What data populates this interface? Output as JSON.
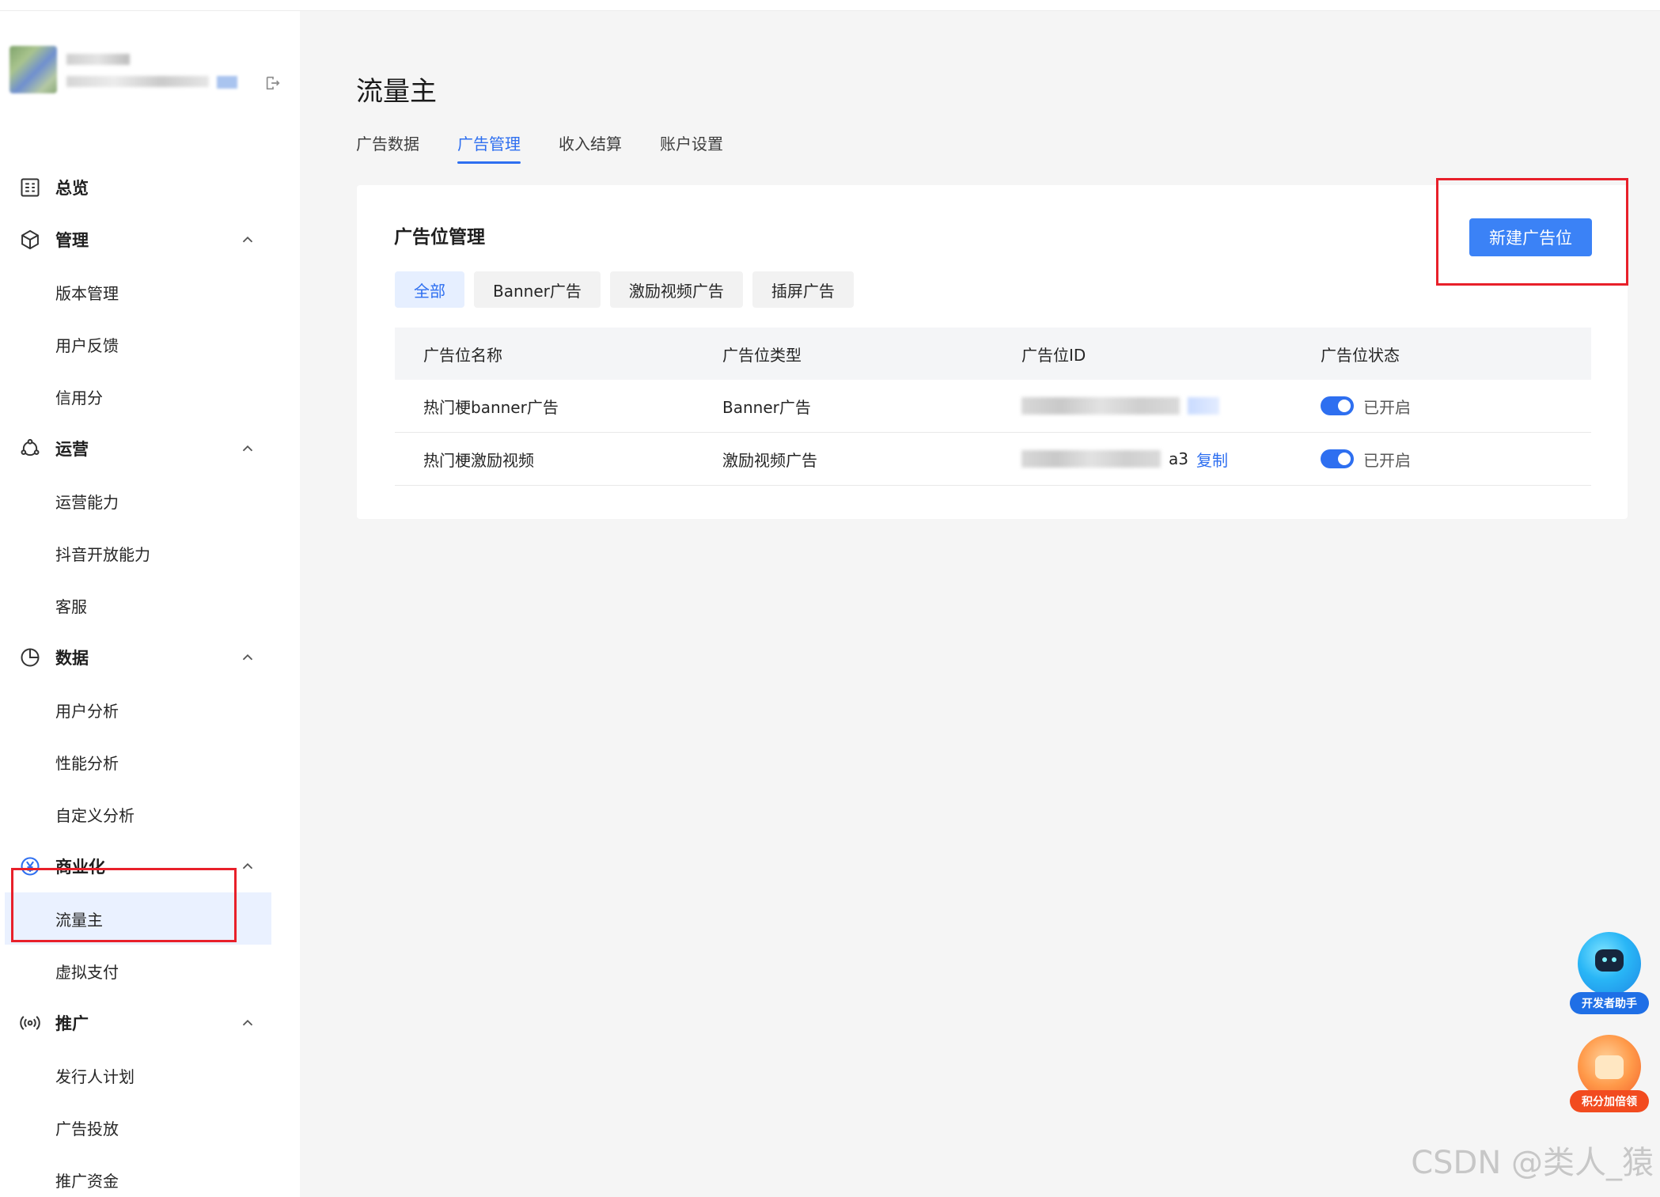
{
  "sidebar": {
    "groups": [
      {
        "label": "总览",
        "icon": "overview-grid-icon",
        "items": []
      },
      {
        "label": "管理",
        "icon": "cube-icon",
        "items": [
          "版本管理",
          "用户反馈",
          "信用分"
        ]
      },
      {
        "label": "运营",
        "icon": "operations-icon",
        "items": [
          "运营能力",
          "抖音开放能力",
          "客服"
        ]
      },
      {
        "label": "数据",
        "icon": "pie-chart-icon",
        "items": [
          "用户分析",
          "性能分析",
          "自定义分析"
        ]
      },
      {
        "label": "商业化",
        "icon": "yen-circle-icon",
        "items": [
          "流量主",
          "虚拟支付"
        ]
      },
      {
        "label": "推广",
        "icon": "broadcast-icon",
        "items": [
          "发行人计划",
          "广告投放",
          "推广资金"
        ]
      }
    ],
    "active_item": "流量主"
  },
  "page": {
    "title": "流量主",
    "tabs": [
      "广告数据",
      "广告管理",
      "收入结算",
      "账户设置"
    ],
    "active_tab": "广告管理"
  },
  "card": {
    "title": "广告位管理",
    "new_button": "新建广告位",
    "filters": [
      "全部",
      "Banner广告",
      "激励视频广告",
      "插屏广告"
    ],
    "active_filter": "全部",
    "table": {
      "headers": [
        "广告位名称",
        "广告位类型",
        "广告位ID",
        "广告位状态"
      ],
      "rows": [
        {
          "name": "热门梗banner广告",
          "type": "Banner广告",
          "id_tail": "",
          "copy": "复制",
          "status": "已开启",
          "enabled": true
        },
        {
          "name": "热门梗激励视频",
          "type": "激励视频广告",
          "id_tail": "a3",
          "copy": "复制",
          "status": "已开启",
          "enabled": true
        }
      ]
    }
  },
  "floating": {
    "helper_label": "开发者助手",
    "points_label": "积分加倍领"
  },
  "watermark": "CSDN @类人_猿",
  "colors": {
    "accent": "#2e6ff0",
    "button": "#3b82f6",
    "highlight_box": "#e8202a",
    "active_nav_bg": "#eaf1ff"
  }
}
